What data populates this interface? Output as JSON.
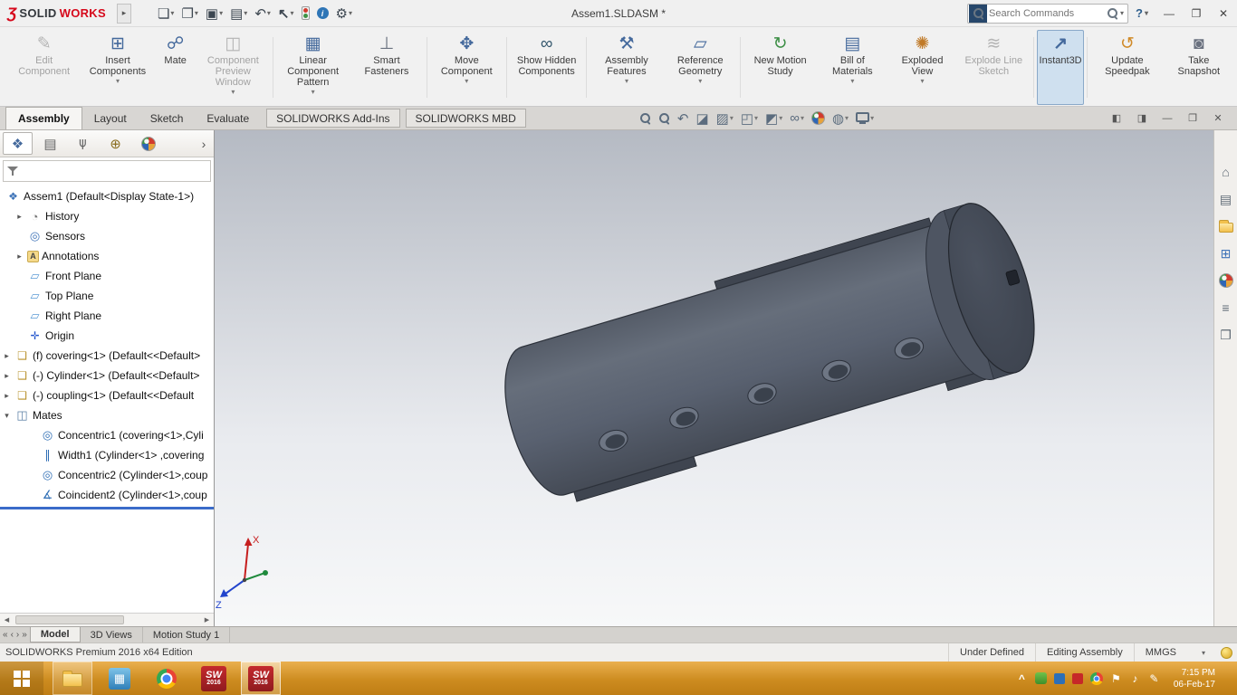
{
  "colors": {
    "accent_red": "#d6081b",
    "taskbar_gold": "#d79a36",
    "model_gray": "#5a6170",
    "rollback_blue": "#3a6bc9",
    "instant3d_active_bg": "#cfe0ef"
  },
  "icons": {
    "ds_logo": "Ʒ",
    "menu_expand": "▸",
    "dropdown": "▾",
    "new_document": "❏",
    "open_folder": "❐",
    "save": "▣",
    "print": "▤",
    "undo": "↶",
    "select_cursor": "↖",
    "file_properties": "i",
    "options_gear": "⚙",
    "help": "?",
    "minimize": "—",
    "maximize": "❐",
    "close": "✕",
    "pane_left": "◧",
    "pane_right": "◨",
    "edit_component": "✎",
    "insert_components": "⊞",
    "mate": "☍",
    "component_preview": "◫",
    "linear_pattern": "▦",
    "smart_fasteners": "⊥",
    "move_component": "✥",
    "show_hidden": "∞",
    "assembly_features": "⚒",
    "reference_geometry": "▱",
    "new_motion_study": "↻",
    "bill_of_materials": "▤",
    "exploded_view": "✺",
    "explode_line_sketch": "≋",
    "instant3d": "↗",
    "update_speedpak": "↺",
    "take_snapshot": "◙",
    "previous_view": "↶",
    "section_view": "◪",
    "annotation_views": "▨",
    "view_orientation": "◰",
    "display_style": "◩",
    "hide_show_items": "∞",
    "apply_scene": "◍",
    "expand_flyout": "›",
    "mgr_feature": "❖",
    "mgr_property": "▤",
    "mgr_config": "⋔",
    "mgr_dimxpert": "⊕",
    "tree_assembly": "❖",
    "tree_history": "◔",
    "tree_sensors": "◎",
    "tree_annotations": "A",
    "tree_plane": "▱",
    "tree_origin": "✛",
    "tree_part": "❑",
    "tree_mates": "◫",
    "tree_concentric": "◎",
    "tree_width": "∥",
    "tree_coincident": "∡",
    "arrow_collapsed": "▸",
    "arrow_expanded": "▾",
    "nav_first": "«",
    "nav_prev": "‹",
    "nav_next": "›",
    "nav_last": "»",
    "tp_home": "⌂",
    "tp_library": "▤",
    "tp_palette": "⊞",
    "tp_props": "≡",
    "tp_doc": "❐",
    "app_tile": "▦",
    "tray_caret": "^",
    "tray_flag": "⚑",
    "tray_volume": "♪",
    "tray_pen": "✎",
    "scroll_left": "◀",
    "scroll_right": "▶"
  },
  "titlebar": {
    "brand_solid": "SOLID",
    "brand_works": "WORKS",
    "title": "Assem1.SLDASM *",
    "search_placeholder": "Search Commands"
  },
  "ribbon": {
    "items": [
      {
        "label": "Edit Component",
        "disabled": true,
        "dropdown": false,
        "active": false
      },
      {
        "label": "Insert Components",
        "disabled": false,
        "dropdown": true,
        "active": false
      },
      {
        "label": "Mate",
        "disabled": false,
        "dropdown": false,
        "active": false
      },
      {
        "label": "Component Preview Window",
        "disabled": true,
        "dropdown": true,
        "active": false
      },
      {
        "label": "Linear Component Pattern",
        "disabled": false,
        "dropdown": true,
        "active": false
      },
      {
        "label": "Smart Fasteners",
        "disabled": false,
        "dropdown": false,
        "active": false
      },
      {
        "label": "Move Component",
        "disabled": false,
        "dropdown": true,
        "active": false
      },
      {
        "label": "Show Hidden Components",
        "disabled": false,
        "dropdown": false,
        "active": false
      },
      {
        "label": "Assembly Features",
        "disabled": false,
        "dropdown": true,
        "active": false
      },
      {
        "label": "Reference Geometry",
        "disabled": false,
        "dropdown": true,
        "active": false
      },
      {
        "label": "New Motion Study",
        "disabled": false,
        "dropdown": false,
        "active": false
      },
      {
        "label": "Bill of Materials",
        "disabled": false,
        "dropdown": true,
        "active": false
      },
      {
        "label": "Exploded View",
        "disabled": false,
        "dropdown": true,
        "active": false
      },
      {
        "label": "Explode Line Sketch",
        "disabled": true,
        "dropdown": false,
        "active": false
      },
      {
        "label": "Instant3D",
        "disabled": false,
        "dropdown": false,
        "active": true
      },
      {
        "label": "Update Speedpak",
        "disabled": false,
        "dropdown": false,
        "active": false
      },
      {
        "label": "Take Snapshot",
        "disabled": false,
        "dropdown": false,
        "active": false
      }
    ]
  },
  "command_tabs": {
    "tabs": [
      "Assembly",
      "Layout",
      "Sketch",
      "Evaluate",
      "SOLIDWORKS Add-Ins",
      "SOLIDWORKS MBD"
    ],
    "active": "Assembly"
  },
  "feature_panel": {
    "tree": [
      {
        "label": "Assem1 (Default<Display State-1>)"
      },
      {
        "label": "History"
      },
      {
        "label": "Sensors"
      },
      {
        "label": "Annotations"
      },
      {
        "label": "Front Plane"
      },
      {
        "label": "Top Plane"
      },
      {
        "label": "Right Plane"
      },
      {
        "label": "Origin"
      },
      {
        "label": "(f) covering<1> (Default<<Default>"
      },
      {
        "label": "(-) Cylinder<1> (Default<<Default>"
      },
      {
        "label": "(-) coupling<1> (Default<<Default"
      },
      {
        "label": "Mates"
      },
      {
        "label": "Concentric1 (covering<1>,Cyli"
      },
      {
        "label": "Width1 (Cylinder<1> ,covering"
      },
      {
        "label": "Concentric2 (Cylinder<1>,coup"
      },
      {
        "label": "Coincident2 (Cylinder<1>,coup"
      }
    ]
  },
  "viewport": {
    "triad_x": "X",
    "triad_z": "Z"
  },
  "bottom_tabs": {
    "tabs": [
      "Model",
      "3D Views",
      "Motion Study 1"
    ],
    "active": "Model"
  },
  "status_bar": {
    "edition": "SOLIDWORKS Premium 2016 x64 Edition",
    "definition_state": "Under Defined",
    "mode": "Editing Assembly",
    "units": "MMGS"
  },
  "taskbar": {
    "sw_text": "SW",
    "sw_year": "2016",
    "time": "7:15 PM",
    "date": "06-Feb-17"
  }
}
